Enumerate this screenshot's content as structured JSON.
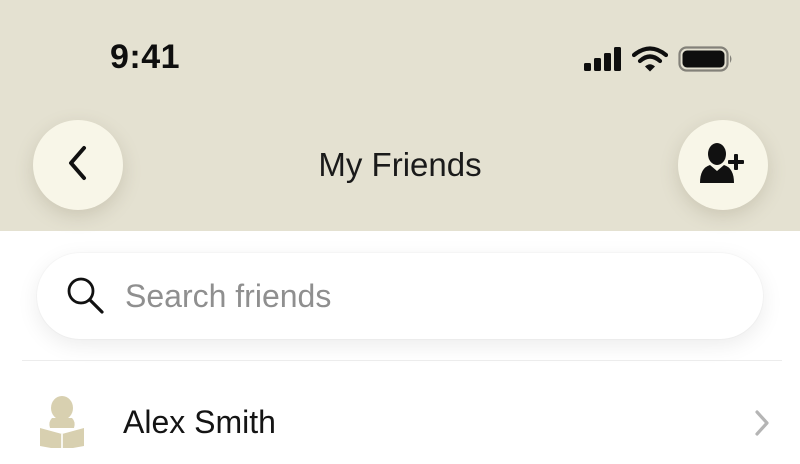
{
  "status_bar": {
    "time": "9:41",
    "icons": [
      "cellular-signal-icon",
      "wifi-icon",
      "battery-icon"
    ]
  },
  "nav": {
    "title": "My Friends",
    "back_icon": "chevron-left-icon",
    "add_icon": "add-person-icon"
  },
  "search": {
    "placeholder": "Search friends",
    "value": "",
    "icon": "search-icon"
  },
  "friends": [
    {
      "name": "Alex Smith",
      "avatar_icon": "person-reading-avatar-icon"
    }
  ],
  "colors": {
    "header_bg": "#e4e1d1",
    "button_bg": "#f8f6e8",
    "avatar": "#d8d0b0",
    "placeholder": "#8f8f8f",
    "chevron": "#b5b5b5"
  }
}
